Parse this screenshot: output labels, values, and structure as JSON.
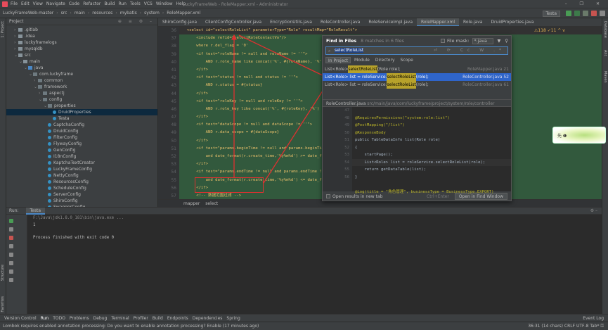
{
  "menubar": {
    "items": [
      "File",
      "Edit",
      "View",
      "Navigate",
      "Code",
      "Refactor",
      "Build",
      "Run",
      "Tools",
      "VCS",
      "Window",
      "Help"
    ],
    "window_title": "LuckyFrameWeb - RoleMapper.xml - Administrator",
    "window_controls": "– ❐ ✕"
  },
  "navbar": {
    "crumbs": [
      "LuckyFrameWeb-master",
      "src",
      "main",
      "resources",
      "mybatis",
      "system",
      "RoleMapper.xml"
    ],
    "run_config": "Testa"
  },
  "project": {
    "title": "Project",
    "tree": [
      {
        "indent": 1,
        "arrow": "›",
        "icon": "folder",
        "label": ".gitlab"
      },
      {
        "indent": 1,
        "arrow": "›",
        "icon": "folder",
        "label": ".idea"
      },
      {
        "indent": 1,
        "arrow": "›",
        "icon": "folder",
        "label": "luckyframelogs"
      },
      {
        "indent": 1,
        "arrow": "›",
        "icon": "folder",
        "label": "mysqldb"
      },
      {
        "indent": 1,
        "arrow": "⌄",
        "icon": "folder",
        "label": "src"
      },
      {
        "indent": 2,
        "arrow": "⌄",
        "icon": "folder",
        "label": "main"
      },
      {
        "indent": 3,
        "arrow": "⌄",
        "icon": "src",
        "label": "java"
      },
      {
        "indent": 4,
        "arrow": "⌄",
        "icon": "pkg",
        "label": "com.luckyframe"
      },
      {
        "indent": 5,
        "arrow": "›",
        "icon": "pkg",
        "label": "common"
      },
      {
        "indent": 5,
        "arrow": "⌄",
        "icon": "pkg",
        "label": "framework"
      },
      {
        "indent": 6,
        "arrow": "›",
        "icon": "pkg",
        "label": "aspectj"
      },
      {
        "indent": 6,
        "arrow": "⌄",
        "icon": "pkg",
        "label": "config"
      },
      {
        "indent": 7,
        "arrow": "⌄",
        "icon": "pkg",
        "label": "properties"
      },
      {
        "indent": 8,
        "arrow": "",
        "icon": "java",
        "label": "DruidProperties",
        "selected": true
      },
      {
        "indent": 8,
        "arrow": "",
        "icon": "java",
        "label": "Testa"
      },
      {
        "indent": 7,
        "arrow": "",
        "icon": "java",
        "label": "CaptchaConfig"
      },
      {
        "indent": 7,
        "arrow": "",
        "icon": "java",
        "label": "DruidConfig"
      },
      {
        "indent": 7,
        "arrow": "",
        "icon": "java",
        "label": "FilterConfig"
      },
      {
        "indent": 7,
        "arrow": "",
        "icon": "java",
        "label": "FlywayConfig"
      },
      {
        "indent": 7,
        "arrow": "",
        "icon": "java",
        "label": "GenConfig"
      },
      {
        "indent": 7,
        "arrow": "",
        "icon": "java",
        "label": "I18nConfig"
      },
      {
        "indent": 7,
        "arrow": "",
        "icon": "java",
        "label": "KaptchaTextCreator"
      },
      {
        "indent": 7,
        "arrow": "",
        "icon": "java",
        "label": "LuckyFrameConfig"
      },
      {
        "indent": 7,
        "arrow": "",
        "icon": "java",
        "label": "NettyConfig"
      },
      {
        "indent": 7,
        "arrow": "",
        "icon": "java",
        "label": "ResourcesConfig"
      },
      {
        "indent": 7,
        "arrow": "",
        "icon": "java",
        "label": "ScheduleConfig"
      },
      {
        "indent": 7,
        "arrow": "",
        "icon": "java",
        "label": "ServerConfig"
      },
      {
        "indent": 7,
        "arrow": "",
        "icon": "java",
        "label": "ShiroConfig"
      },
      {
        "indent": 7,
        "arrow": "",
        "icon": "java",
        "label": "SwaggerConfig"
      }
    ]
  },
  "tabs": [
    "ShiroConfig.java",
    "ClientConfigController.java",
    "EncryptionUtils.java",
    "RoleController.java",
    "RoleServiceImpl.java",
    "RoleMapper.xml",
    "Role.java",
    "DruidProperties.java"
  ],
  "active_tab": "RoleMapper.xml",
  "editor": {
    "line_numbers": [
      "36",
      "37",
      "38",
      "39",
      "40",
      "41",
      "42",
      "43",
      "44",
      "45",
      "46",
      "47",
      "48",
      "49",
      "50",
      "51",
      "52",
      "53",
      "54",
      "55",
      "56",
      "57",
      "58",
      "59"
    ],
    "lines": [
      "  <select id=\"selectRoleList\" parameterType=\"Role\" resultMap=\"RoleResult\">",
      "      <include refid=\"selectRoleContactVo\"/>",
      "      where r.del_flag = '0'",
      "      <if test=\"roleName != null and roleName != ''\">",
      "          AND r.role_name like concat('%', #{roleName}, '%')",
      "      </if>",
      "      <if test=\"status != null and status != ''\">",
      "          AND r.status = #{status}",
      "      </if>",
      "      <if test=\"roleKey != null and roleKey != ''\">",
      "          AND r.role_key like concat('%', #{roleKey}, '%')",
      "      </if>",
      "      <if test=\"dataScope != null and dataScope != ''\">",
      "          AND r.data_scope = #{dataScope}",
      "      </if>",
      "      <if test=\"params.beginTime != null and params.beginTime != ''\">",
      "          and date_format(r.create_time,'%y%m%d') >= date_format(",
      "      </if>",
      "      <if test=\"params.endTime != null and params.endTime != ''\">",
      "          and date_format(r.create_time,'%y%m%d') <= date_format(",
      "      </if>",
      "      <!-- 数据范围过滤 -->",
      "      ${params.dataScope}",
      "  </select>"
    ],
    "footer_crumbs": [
      "mapper",
      "select"
    ],
    "inspection": "⚠118 ✓11 ^ v"
  },
  "find_in_files": {
    "title": "Find in Files",
    "match_summary": "8 matches in 6 files",
    "file_mask_label": "File mask:",
    "file_mask_value": "*.java",
    "query": "selectRoleList",
    "scopes": [
      "In Project",
      "Module",
      "Directory",
      "Scope"
    ],
    "results": [
      {
        "pre": "List<Role> ",
        "hit": "selectRoleList",
        "post": "(Role role);",
        "loc": "RoleMapper.java 21"
      },
      {
        "pre": "List<Role> list = roleService.",
        "hit": "selectRoleList",
        "post": "(role);",
        "loc": "RoleController.java 52",
        "selected": true
      },
      {
        "pre": "List<Role> list = roleService.",
        "hit": "selectRoleList",
        "post": "(role);",
        "loc": "RoleController.java 61"
      },
      {
        "pre": "",
        "hit": "",
        "post": "",
        "loc": ""
      }
    ],
    "preview_path": "RoleController.java",
    "preview_dir": "src/main/java/com/luckyframe/project/system/role/controller",
    "preview_lines": [
      "47",
      "48",
      "49",
      "50",
      "51",
      "52",
      "53",
      "54",
      "55",
      "56"
    ],
    "preview_code": [
      "",
      "@RequiresPermissions(\"system:role:list\")",
      "@PostMapping(\"/list\")",
      "@ResponseBody",
      "public TableDataInfo list(Role role)",
      "{",
      "    startPage();",
      "    List<Role> list = roleService.selectRoleList(role);",
      "    return getDataTable(list);",
      "}",
      "",
      "@Log(title = \"角色管理\", businessType = BusinessType.EXPORT)"
    ],
    "open_new_tab": "Open results in new tab",
    "shortcut": "Ctrl+Enter",
    "open_button": "Open in Find Window"
  },
  "toast_text": "先  ❶",
  "run": {
    "label": "Run:",
    "tab": "Testa",
    "console_path": "F:\\Java\\jdk1.8.0_181\\bin\\java.exe ...",
    "console_output": "1",
    "console_exit": "Process finished with exit code 0"
  },
  "bottom_tabs": [
    "Version Control",
    "Run",
    "TODO",
    "Problems",
    "Debug",
    "Terminal",
    "Profiler",
    "Build",
    "Endpoints",
    "Dependencies",
    "Spring"
  ],
  "event_log": "Event Log",
  "status": {
    "message": "Lombok requires enabled annotation processing: Do you want to enable annotation processing? Enable (17 minutes ago)",
    "position": "36:31 (14 chars)  CRLF  UTF-8  Tab*  ⚿"
  },
  "colors": {
    "accent": "#4a88c7",
    "selection": "#2f65ca",
    "red_annotation": "#e03030",
    "match": "#b7a22b"
  }
}
